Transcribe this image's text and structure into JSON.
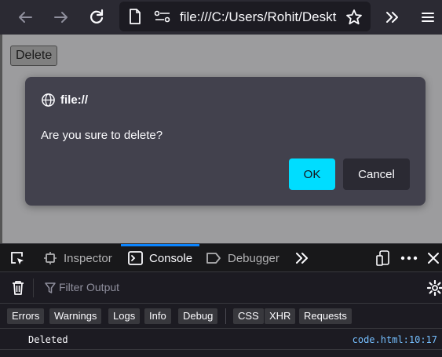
{
  "toolbar": {
    "url": "file:///C:/Users/Rohit/Deskt"
  },
  "page": {
    "delete_label": "Delete"
  },
  "dialog": {
    "title": "file://",
    "message": "Are you sure to delete?",
    "ok_label": "OK",
    "cancel_label": "Cancel",
    "accent": "#00ddff"
  },
  "devtools": {
    "tabs": [
      "Inspector",
      "Console",
      "Debugger"
    ],
    "active_tab": "Console",
    "filter_placeholder": "Filter Output",
    "chips": [
      "Errors",
      "Warnings",
      "Logs",
      "Info",
      "Debug",
      "CSS",
      "XHR",
      "Requests"
    ],
    "log": {
      "message": "Deleted",
      "location": "code.html:10:17"
    }
  }
}
